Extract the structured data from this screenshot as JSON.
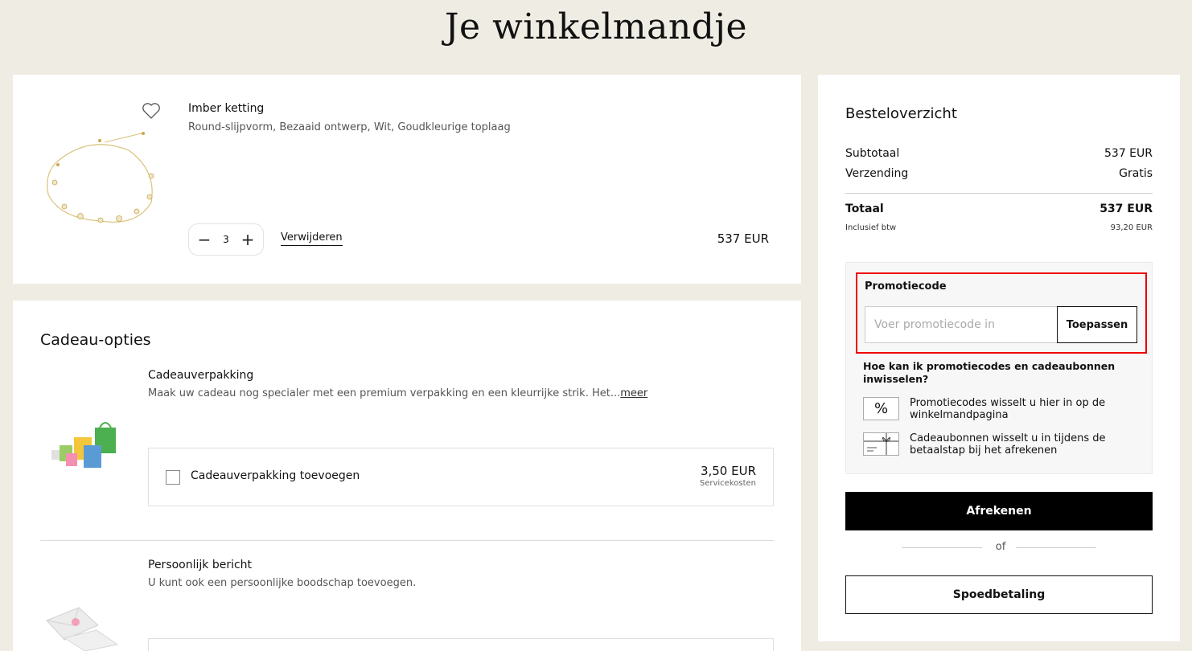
{
  "page": {
    "title": "Je winkelmandje"
  },
  "product": {
    "name": "Imber ketting",
    "description": "Round-slijpvorm, Bezaaid ontwerp, Wit, Goudkleurige toplaag",
    "quantity": "3",
    "remove_label": "Verwijderen",
    "price": "537 EUR",
    "icons": {
      "wishlist": "heart-icon",
      "decrease": "minus-icon",
      "increase": "plus-icon"
    }
  },
  "gift": {
    "title": "Cadeau-opties",
    "wrapping": {
      "title": "Cadeauverpakking",
      "description": "Maak uw cadeau nog specialer met een premium verpakking en een kleurrijke strik. Het...",
      "more_label": "meer",
      "checkbox_label": "Cadeauverpakking toevoegen",
      "price": "3,50 EUR",
      "price_note": "Servicekosten"
    },
    "message": {
      "title": "Persoonlijk bericht",
      "description": "U kunt ook een persoonlijke boodschap toevoegen."
    }
  },
  "summary": {
    "title": "Besteloverzicht",
    "subtotal_label": "Subtotaal",
    "subtotal_value": "537 EUR",
    "shipping_label": "Verzending",
    "shipping_value": "Gratis",
    "total_label": "Totaal",
    "total_value": "537 EUR",
    "vat_label": "Inclusief btw",
    "vat_value": "93,20 EUR"
  },
  "promo": {
    "label": "Promotiecode",
    "placeholder": "Voer promotiecode in",
    "apply_label": "Toepassen",
    "howto_title": "Hoe kan ik promotiecodes en cadeaubonnen inwisselen?",
    "info_promo": "Promotiecodes wisselt u hier in op de winkelmandpagina",
    "info_promo_icon": "%",
    "info_giftcard": "Cadeaubonnen wisselt u in tijdens de betaalstap bij het afrekenen"
  },
  "actions": {
    "checkout_label": "Afrekenen",
    "or_label": "of",
    "express_label": "Spoedbetaling"
  },
  "colors": {
    "background": "#efece4",
    "highlight": "#e00000",
    "primary": "#000000"
  }
}
